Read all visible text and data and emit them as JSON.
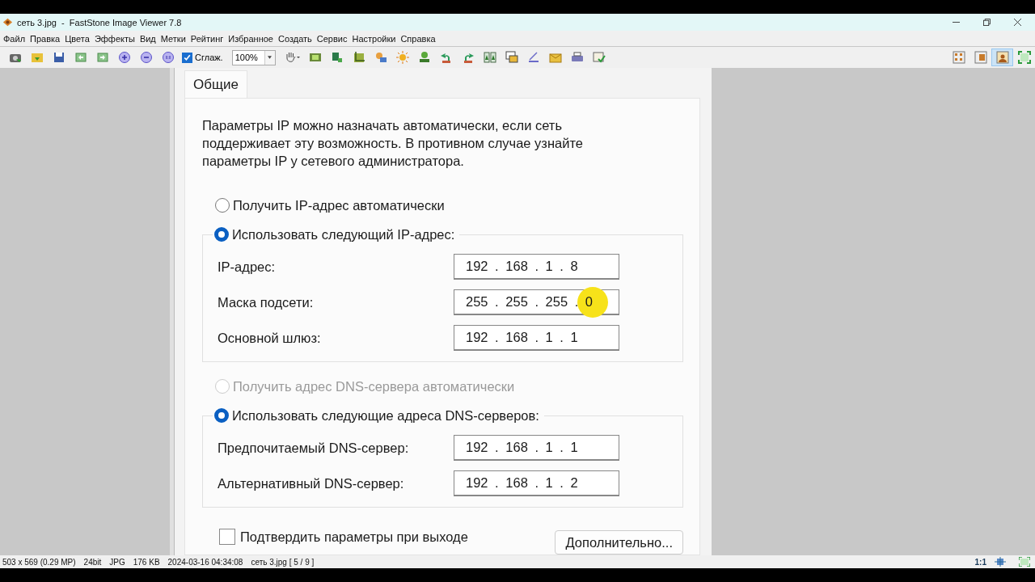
{
  "window": {
    "title": "сеть 3.jpg  -  FastStone Image Viewer 7.8"
  },
  "menu": [
    "Файл",
    "Правка",
    "Цвета",
    "Эффекты",
    "Вид",
    "Метки",
    "Рейтинг",
    "Избранное",
    "Создать",
    "Сервис",
    "Настройки",
    "Справка"
  ],
  "toolbar": {
    "smoothing": {
      "label": "Сглаж.",
      "checked": true
    },
    "zoom": "100%",
    "view_modes": [
      {
        "selected": false
      },
      {
        "selected": false
      },
      {
        "selected": true
      },
      {
        "selected": false
      }
    ]
  },
  "image": {
    "tab": "Общие",
    "description": "Параметры IP можно назначать автоматически, если сеть поддерживает эту возможность. В противном случае узнайте параметры IP у сетевого администратора.",
    "ip_options": [
      {
        "label": "Получить IP-адрес автоматически",
        "selected": false,
        "disabled": false
      },
      {
        "label": "Использовать следующий IP-адрес:",
        "selected": true,
        "disabled": false
      }
    ],
    "ip_fields": [
      {
        "label": "IP-адрес:",
        "value": "192 . 168 . 1 . 8",
        "cursor": false
      },
      {
        "label": "Маска подсети:",
        "value": "255 . 255 . 255 . 0",
        "cursor": true
      },
      {
        "label": "Основной шлюз:",
        "value": "192 . 168 . 1 . 1",
        "cursor": false
      }
    ],
    "dns_options": [
      {
        "label": "Получить адрес DNS-сервера автоматически",
        "selected": false,
        "disabled": true
      },
      {
        "label": "Использовать следующие адреса DNS-серверов:",
        "selected": true,
        "disabled": false
      }
    ],
    "dns_fields": [
      {
        "label": "Предпочитаемый DNS-сервер:",
        "value": "192 . 168 . 1 . 1",
        "cursor": false
      },
      {
        "label": "Альтернативный DNS-сервер:",
        "value": "192 . 168 . 1 . 2",
        "cursor": false
      }
    ],
    "confirm": {
      "label": "Подтвердить параметры при выходе",
      "checked": false
    },
    "advanced_button": "Дополнительно..."
  },
  "status_bar": [
    "503 x 569 (0.29 MP)",
    "24bit",
    "JPG",
    "176 KB",
    "2024-03-16 04:34:08",
    "сеть 3.jpg [ 5 / 9 ]"
  ],
  "status_right": {
    "actual_size": "1:1"
  }
}
